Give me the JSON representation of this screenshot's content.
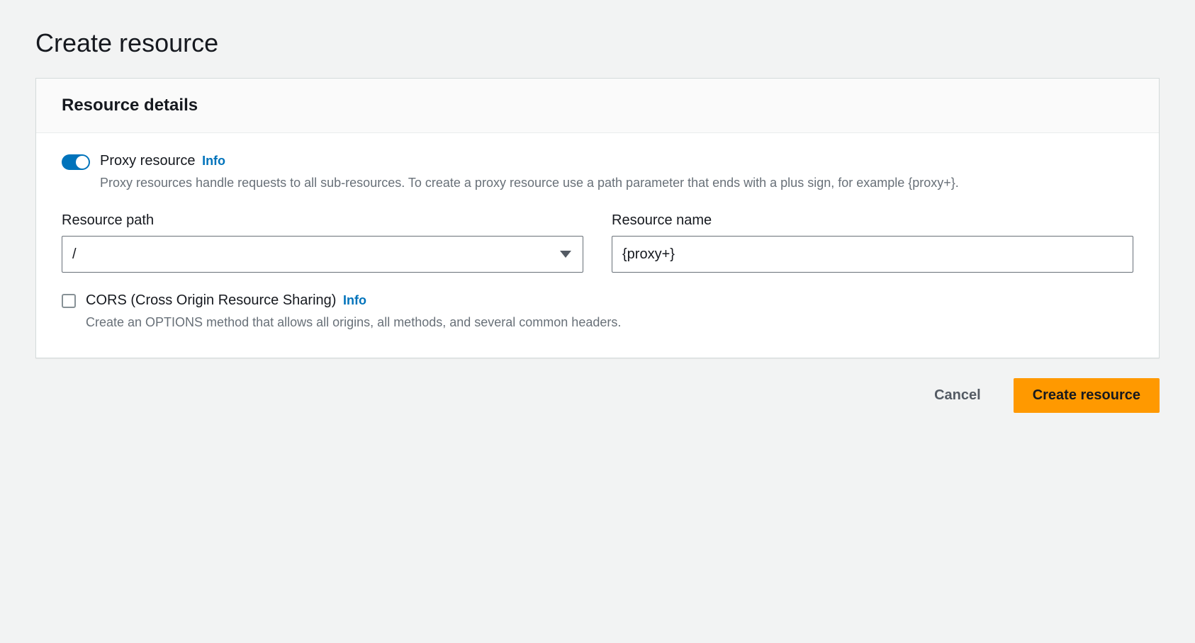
{
  "page": {
    "title": "Create resource"
  },
  "panel": {
    "header": "Resource details"
  },
  "proxy": {
    "label": "Proxy resource",
    "info": "Info",
    "description": "Proxy resources handle requests to all sub-resources. To create a proxy resource use a path parameter that ends with a plus sign, for example {proxy+}.",
    "enabled": true
  },
  "path": {
    "label": "Resource path",
    "value": "/"
  },
  "name": {
    "label": "Resource name",
    "value": "{proxy+}"
  },
  "cors": {
    "label": "CORS (Cross Origin Resource Sharing)",
    "info": "Info",
    "description": "Create an OPTIONS method that allows all origins, all methods, and several common headers.",
    "checked": false
  },
  "actions": {
    "cancel": "Cancel",
    "submit": "Create resource"
  }
}
